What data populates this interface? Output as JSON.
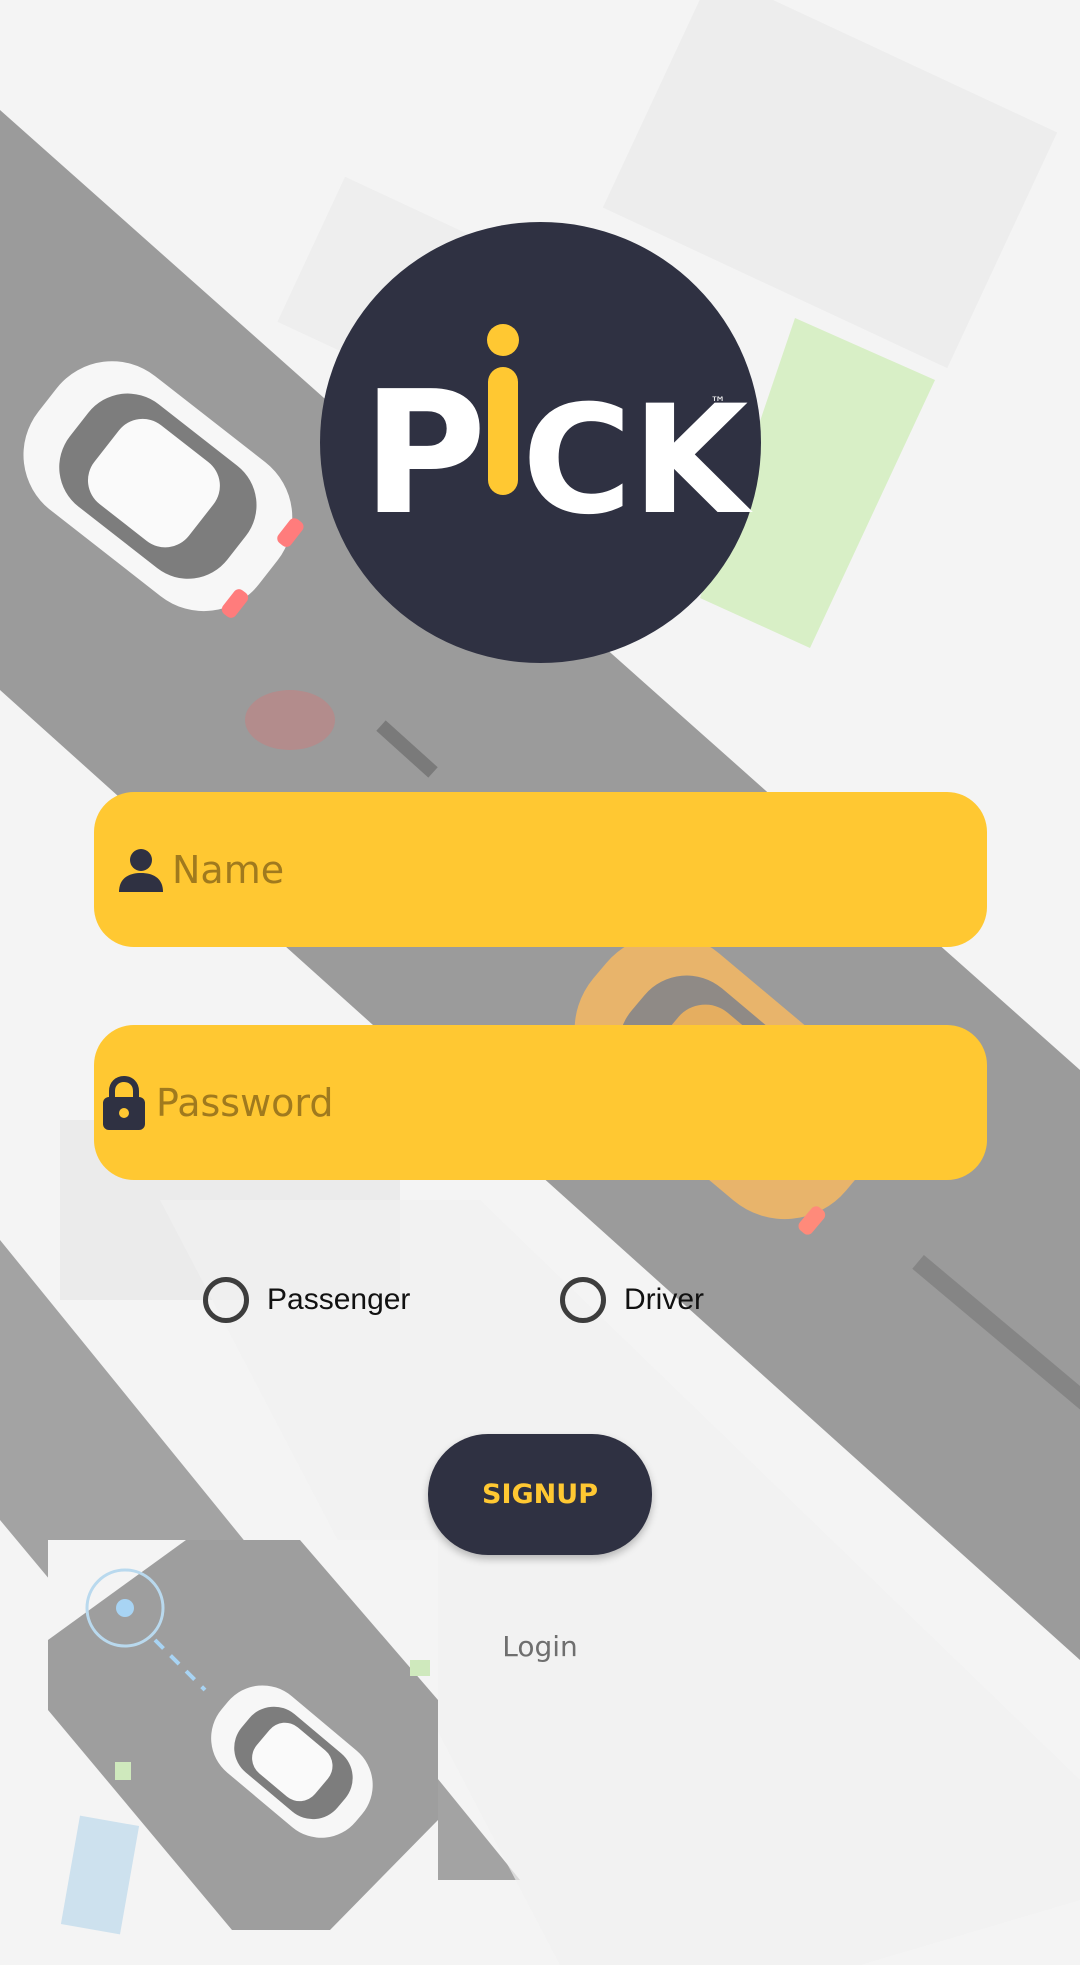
{
  "logo": {
    "text_p": "P",
    "text_i_stem": "i",
    "text_ck": "CK",
    "trademark": "™",
    "circle_color": "#2f3142",
    "accent_color": "#ffc832"
  },
  "form": {
    "name_field": {
      "placeholder": "Name",
      "value": "",
      "icon": "person-icon"
    },
    "password_field": {
      "placeholder": "Password",
      "value": "",
      "icon": "lock-icon"
    },
    "role_options": [
      {
        "label": "Passenger",
        "selected": false
      },
      {
        "label": "Driver",
        "selected": false
      }
    ],
    "signup_label": "SIGNUP",
    "login_label": "Login"
  },
  "colors": {
    "field_background": "#ffc832",
    "button_background": "#2f3142",
    "button_text": "#ffc832",
    "road": "#9e9e9e",
    "background": "#f5f5f5"
  }
}
